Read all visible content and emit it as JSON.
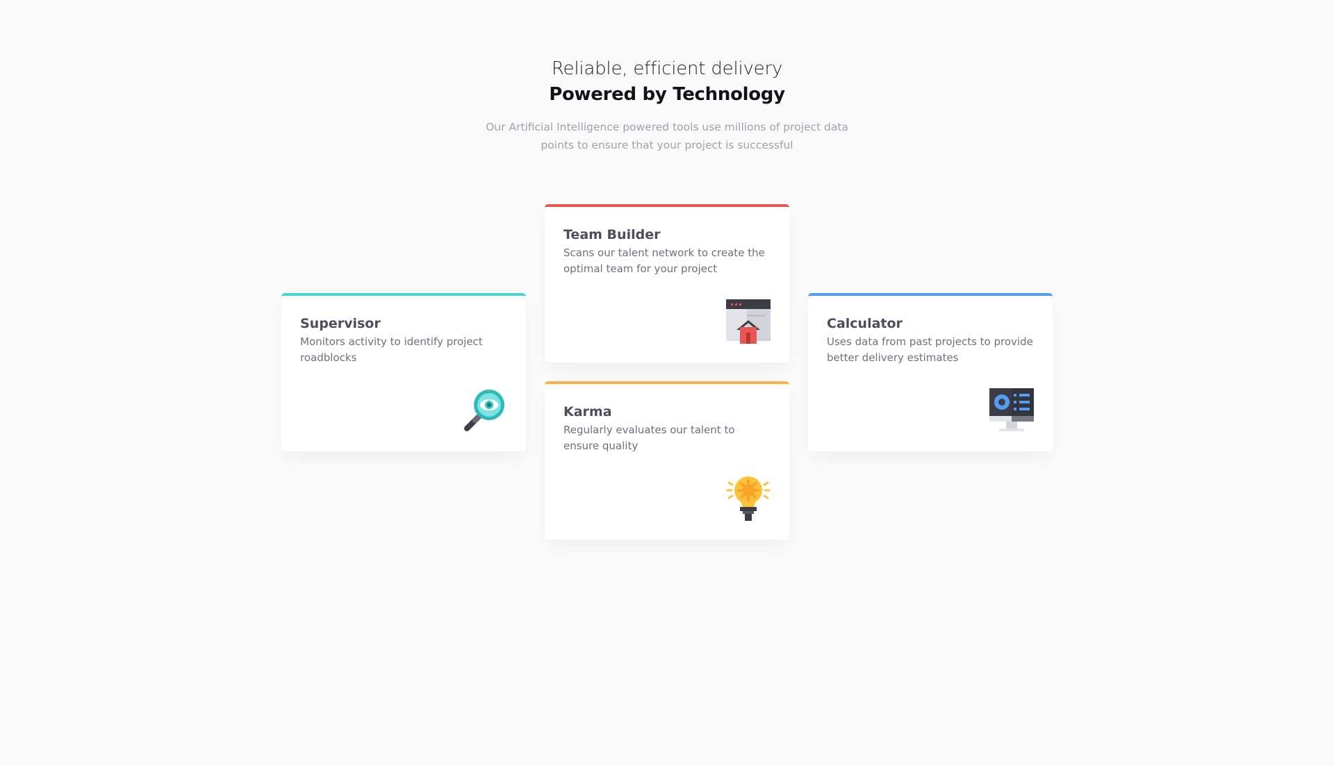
{
  "header": {
    "subtitle": "Reliable, efficient delivery",
    "title": "Powered by Technology",
    "intro": "Our Artificial Intelligence powered tools use millions of project data points to ensure that your project is successful"
  },
  "cards": [
    {
      "title": "Supervisor",
      "description": "Monitors activity to identify project roadblocks",
      "icon": "magnifier-eye-icon",
      "accent": "#45d3d3"
    },
    {
      "title": "Team Builder",
      "description": "Scans our talent network to create the optimal team for your project",
      "icon": "team-builder-icon",
      "accent": "#ea5454"
    },
    {
      "title": "Karma",
      "description": "Regularly evaluates our talent to ensure quality",
      "icon": "lightbulb-icon",
      "accent": "#fcaf4a"
    },
    {
      "title": "Calculator",
      "description": "Uses data from past projects to provide better delivery estimates",
      "icon": "monitor-calculator-icon",
      "accent": "#549ef2"
    }
  ]
}
